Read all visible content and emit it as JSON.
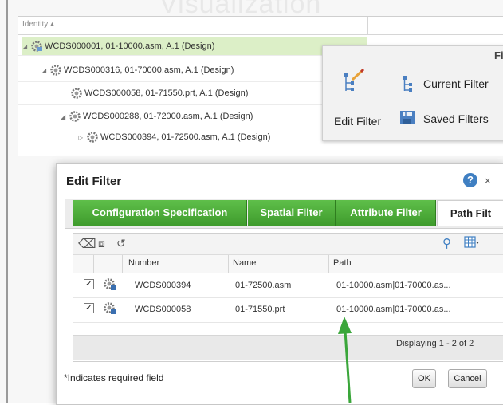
{
  "background": {
    "watermark": "Visualization",
    "column_header": "Identity ▴",
    "tree_rows": [
      "WCDS000001, 01-10000.asm, A.1 (Design)",
      "WCDS000316, 01-70000.asm, A.1 (Design)",
      "WCDS000058, 01-71550.prt, A.1 (Design)",
      "WCDS000288, 01-72000.asm, A.1 (Design)",
      "WCDS000394, 01-72500.asm, A.1 (Design)"
    ]
  },
  "filter_toolbar": {
    "title": "Filte",
    "edit_filter": "Edit Filter",
    "current_filter": "Current Filter",
    "saved_filters": "Saved Filters"
  },
  "dialog": {
    "title": "Edit Filter",
    "help": "?",
    "close": "×",
    "tabs": [
      "Configuration Specification",
      "Spatial Filter",
      "Attribute Filter",
      "Path Filt"
    ],
    "columns": [
      "Number",
      "Name",
      "Path"
    ],
    "rows": [
      {
        "number": "WCDS000394",
        "name": "01-72500.asm",
        "path": "01-10000.asm|01-70000.as..."
      },
      {
        "number": "WCDS000058",
        "name": "01-71550.prt",
        "path": "01-10000.asm|01-70000.as..."
      }
    ],
    "displaying": "Displaying 1 - 2 of 2",
    "required_note": "*Indicates required field",
    "ok": "OK",
    "cancel": "Cancel"
  },
  "colors": {
    "tab_green": "#4caf38",
    "selected_row": "#dcefc7",
    "arrow": "#3aa63a",
    "help_blue": "#3f7fc2"
  }
}
